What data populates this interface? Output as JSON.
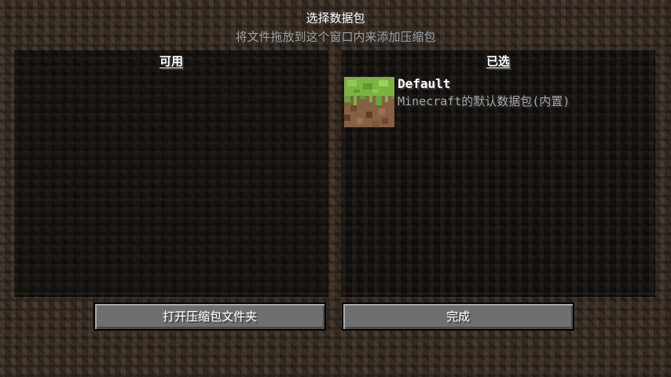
{
  "screen": {
    "title": "选择数据包",
    "subtitle": "将文件拖放到这个窗口内来添加压缩包"
  },
  "available_panel": {
    "heading": "可用",
    "items": []
  },
  "selected_panel": {
    "heading": "已选",
    "items": [
      {
        "name": "Default",
        "description": "Minecraft的默认数据包(内置)",
        "icon": "grass-block-icon"
      }
    ]
  },
  "buttons": {
    "open_folder": "打开压缩包文件夹",
    "done": "完成"
  }
}
